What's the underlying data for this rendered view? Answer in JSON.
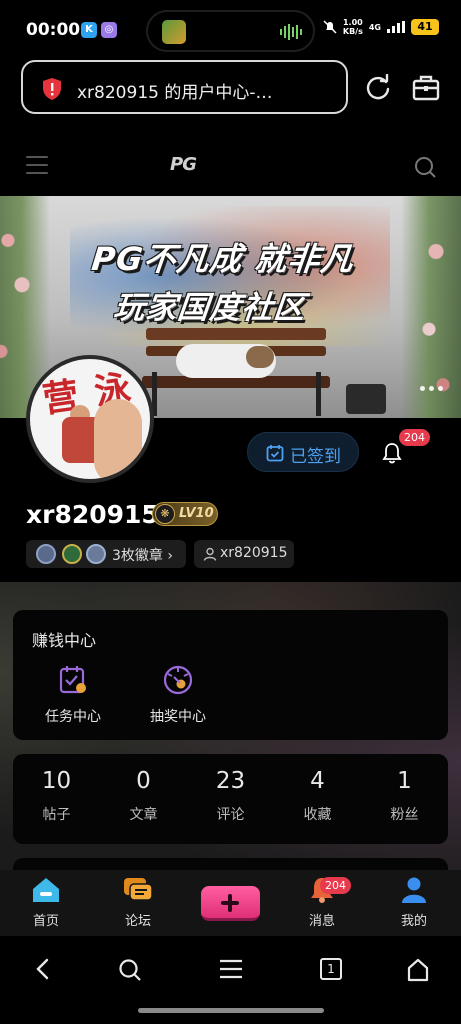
{
  "status_bar": {
    "time": "00:00",
    "app1_letter": "K",
    "net_speed_value": "1.00",
    "net_speed_unit": "KB/s",
    "network": "4G",
    "battery": "41"
  },
  "url_bar": {
    "title": "xr820915 的用户中心-…"
  },
  "site": {
    "logo": "PG"
  },
  "banner": {
    "line1": "PG不凡成 就非凡",
    "line2": "玩家国度社区"
  },
  "profile": {
    "sign_in_label": "已签到",
    "notification_count": "204",
    "username": "xr820915",
    "level_label": "LV10",
    "badges_label": "3枚徽章 ›",
    "account_label": "xr820915"
  },
  "earn_center": {
    "title": "赚钱中心",
    "items": [
      {
        "label": "任务中心",
        "icon": "task-icon"
      },
      {
        "label": "抽奖中心",
        "icon": "lottery-icon"
      }
    ]
  },
  "stats": [
    {
      "value": "10",
      "label": "帖子"
    },
    {
      "value": "0",
      "label": "文章"
    },
    {
      "value": "23",
      "label": "评论"
    },
    {
      "value": "4",
      "label": "收藏"
    },
    {
      "value": "1",
      "label": "粉丝"
    }
  ],
  "tabbar": {
    "items": [
      {
        "label": "首页",
        "icon": "home-icon"
      },
      {
        "label": "论坛",
        "icon": "forum-icon"
      },
      {
        "label": "",
        "icon": "plus-icon"
      },
      {
        "label": "消息",
        "icon": "bell-icon"
      },
      {
        "label": "我的",
        "icon": "user-icon"
      }
    ],
    "message_count": "204"
  },
  "system_nav": {
    "tabs_count": "1"
  },
  "colors": {
    "accent_blue": "#4ea0f0",
    "badge_red": "#e83a4d",
    "plus_pink": "#f0468a"
  }
}
